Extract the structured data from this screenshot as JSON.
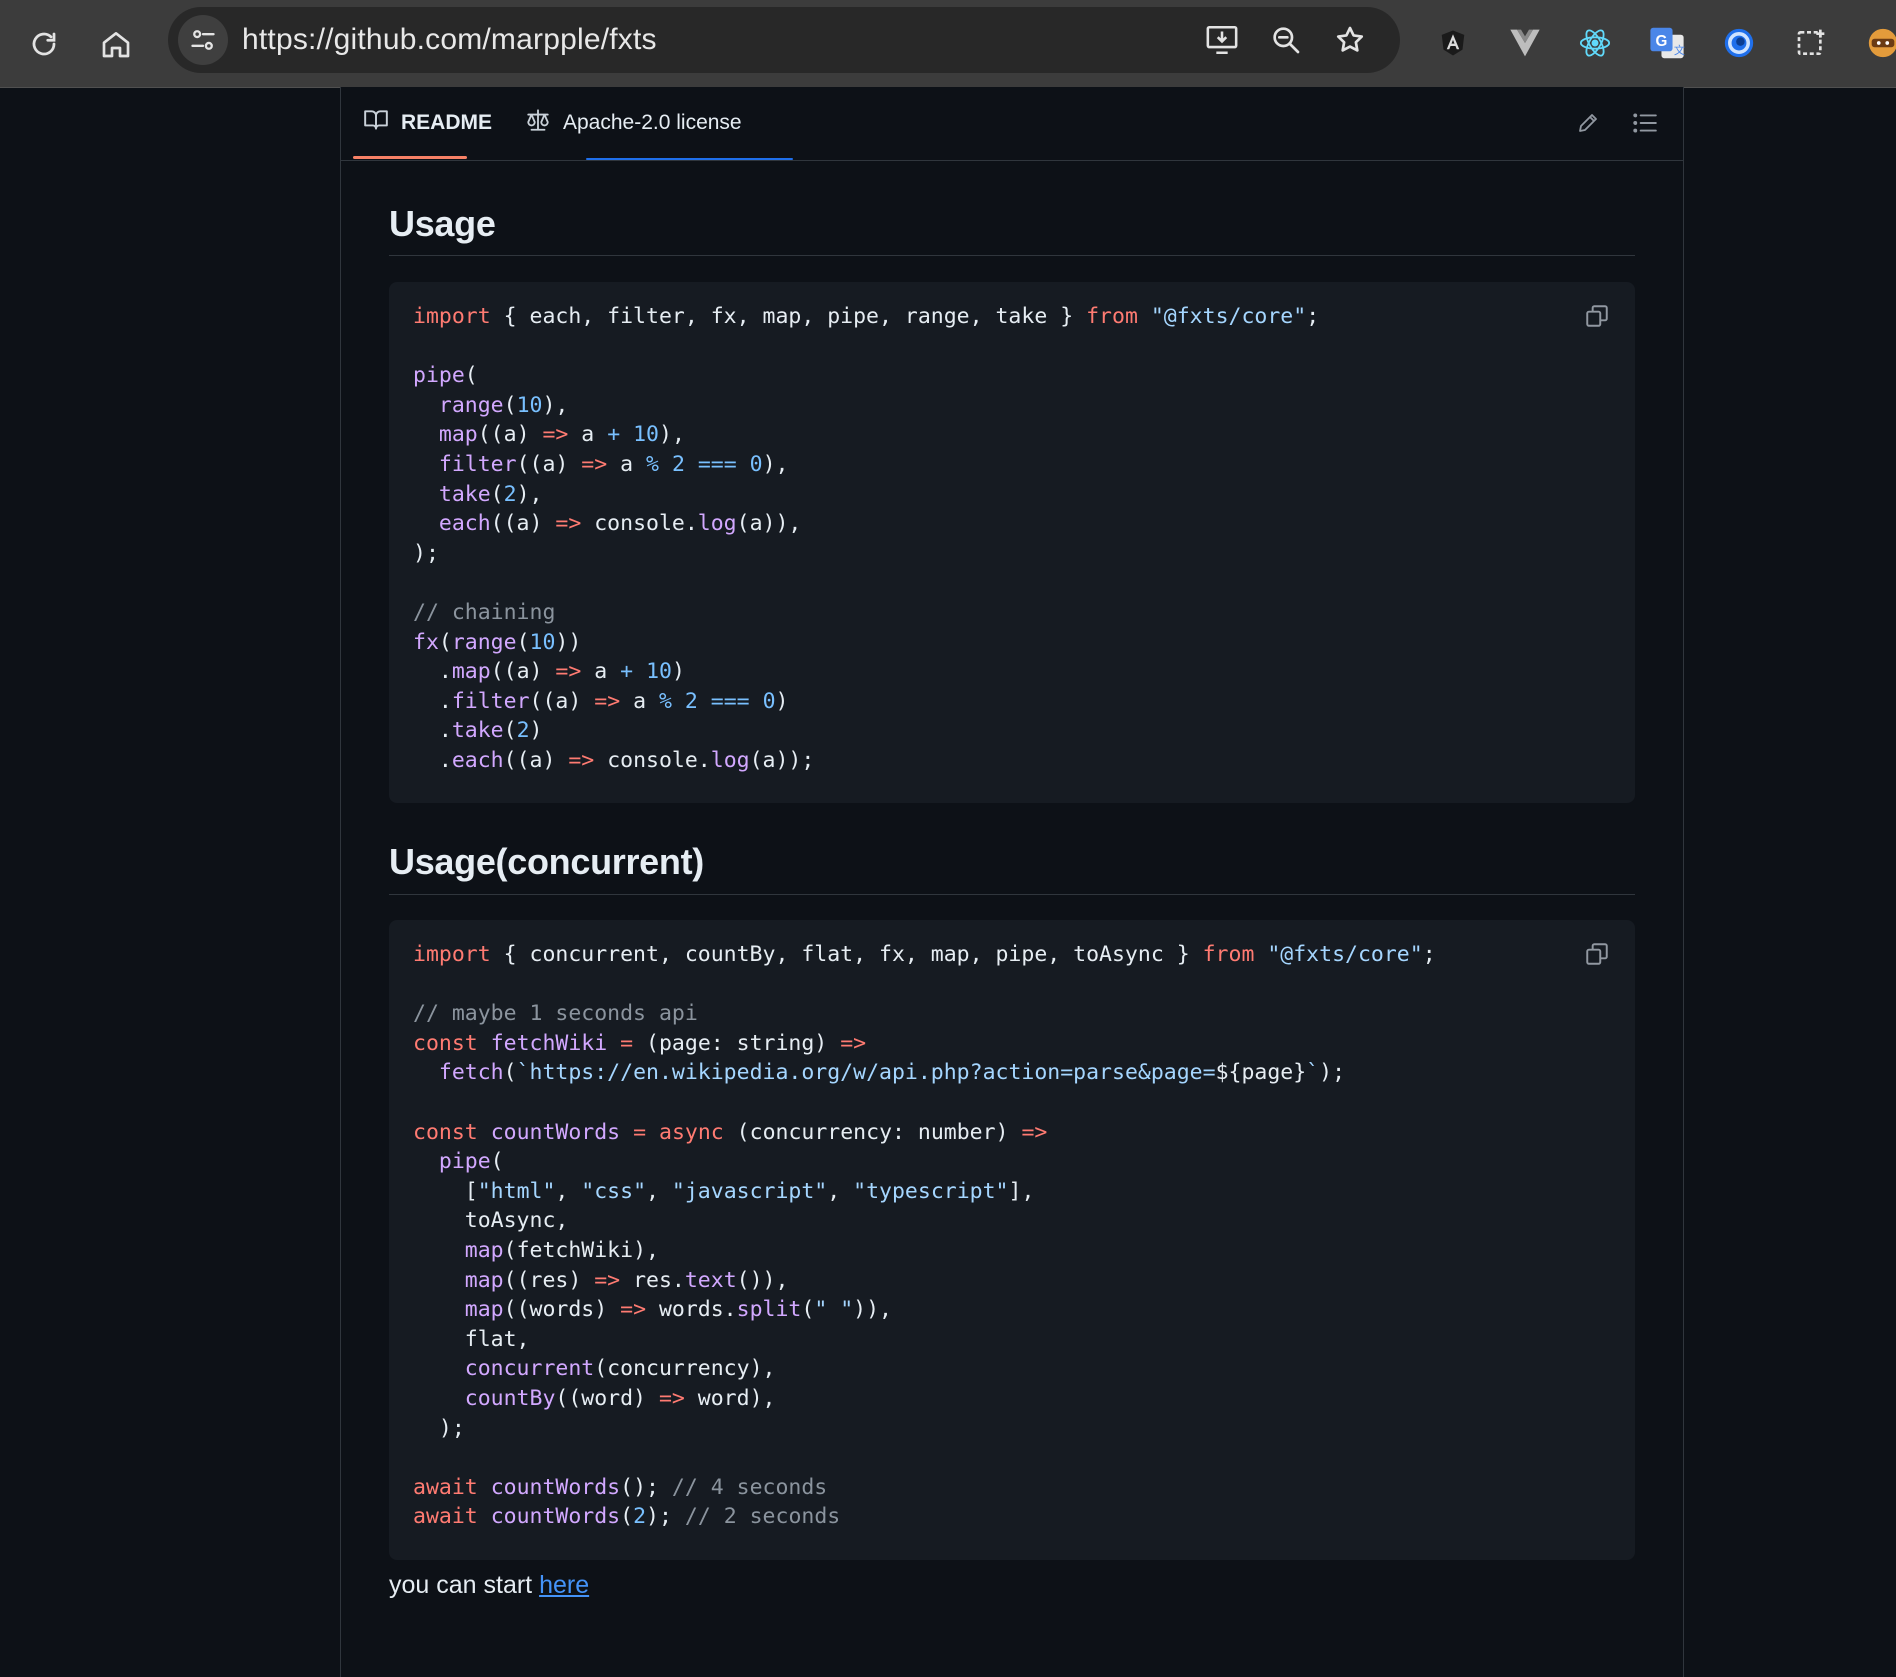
{
  "browser": {
    "url": "https://github.com/marpple/fxts"
  },
  "tabs": [
    {
      "label": "README",
      "icon": "book-icon",
      "active": true
    },
    {
      "label": "Apache-2.0 license",
      "icon": "scale-icon",
      "active": false
    }
  ],
  "sections": [
    {
      "heading": "Usage",
      "code": [
        [
          [
            "k",
            "import"
          ],
          [
            "p",
            " { each, filter, fx, map, pipe, range, take } "
          ],
          [
            "k",
            "from"
          ],
          [
            "p",
            " "
          ],
          [
            "s",
            "\"@fxts/core\""
          ],
          [
            "p",
            ";"
          ]
        ],
        [],
        [
          [
            "f",
            "pipe"
          ],
          [
            "p",
            "("
          ]
        ],
        [
          [
            "p",
            "  "
          ],
          [
            "f",
            "range"
          ],
          [
            "p",
            "("
          ],
          [
            "n",
            "10"
          ],
          [
            "p",
            "),"
          ]
        ],
        [
          [
            "p",
            "  "
          ],
          [
            "f",
            "map"
          ],
          [
            "p",
            "((a) "
          ],
          [
            "k",
            "=>"
          ],
          [
            "p",
            " a "
          ],
          [
            "n",
            "+"
          ],
          [
            "p",
            " "
          ],
          [
            "n",
            "10"
          ],
          [
            "p",
            "),"
          ]
        ],
        [
          [
            "p",
            "  "
          ],
          [
            "f",
            "filter"
          ],
          [
            "p",
            "((a) "
          ],
          [
            "k",
            "=>"
          ],
          [
            "p",
            " a "
          ],
          [
            "n",
            "%"
          ],
          [
            "p",
            " "
          ],
          [
            "n",
            "2"
          ],
          [
            "p",
            " "
          ],
          [
            "n",
            "==="
          ],
          [
            "p",
            " "
          ],
          [
            "n",
            "0"
          ],
          [
            "p",
            "),"
          ]
        ],
        [
          [
            "p",
            "  "
          ],
          [
            "f",
            "take"
          ],
          [
            "p",
            "("
          ],
          [
            "n",
            "2"
          ],
          [
            "p",
            "),"
          ]
        ],
        [
          [
            "p",
            "  "
          ],
          [
            "f",
            "each"
          ],
          [
            "p",
            "((a) "
          ],
          [
            "k",
            "=>"
          ],
          [
            "p",
            " console."
          ],
          [
            "f",
            "log"
          ],
          [
            "p",
            "(a)),"
          ]
        ],
        [
          [
            "p",
            ");"
          ]
        ],
        [],
        [
          [
            "c",
            "// chaining"
          ]
        ],
        [
          [
            "f",
            "fx"
          ],
          [
            "p",
            "("
          ],
          [
            "f",
            "range"
          ],
          [
            "p",
            "("
          ],
          [
            "n",
            "10"
          ],
          [
            "p",
            "))"
          ]
        ],
        [
          [
            "p",
            "  ."
          ],
          [
            "f",
            "map"
          ],
          [
            "p",
            "((a) "
          ],
          [
            "k",
            "=>"
          ],
          [
            "p",
            " a "
          ],
          [
            "n",
            "+"
          ],
          [
            "p",
            " "
          ],
          [
            "n",
            "10"
          ],
          [
            "p",
            ")"
          ]
        ],
        [
          [
            "p",
            "  ."
          ],
          [
            "f",
            "filter"
          ],
          [
            "p",
            "((a) "
          ],
          [
            "k",
            "=>"
          ],
          [
            "p",
            " a "
          ],
          [
            "n",
            "%"
          ],
          [
            "p",
            " "
          ],
          [
            "n",
            "2"
          ],
          [
            "p",
            " "
          ],
          [
            "n",
            "==="
          ],
          [
            "p",
            " "
          ],
          [
            "n",
            "0"
          ],
          [
            "p",
            ")"
          ]
        ],
        [
          [
            "p",
            "  ."
          ],
          [
            "f",
            "take"
          ],
          [
            "p",
            "("
          ],
          [
            "n",
            "2"
          ],
          [
            "p",
            ")"
          ]
        ],
        [
          [
            "p",
            "  ."
          ],
          [
            "f",
            "each"
          ],
          [
            "p",
            "((a) "
          ],
          [
            "k",
            "=>"
          ],
          [
            "p",
            " console."
          ],
          [
            "f",
            "log"
          ],
          [
            "p",
            "(a));"
          ]
        ]
      ]
    },
    {
      "heading": "Usage(concurrent)",
      "code": [
        [
          [
            "k",
            "import"
          ],
          [
            "p",
            " { concurrent, countBy, flat, fx, map, pipe, toAsync } "
          ],
          [
            "k",
            "from"
          ],
          [
            "p",
            " "
          ],
          [
            "s",
            "\"@fxts/core\""
          ],
          [
            "p",
            ";"
          ]
        ],
        [],
        [
          [
            "c",
            "// maybe 1 seconds api"
          ]
        ],
        [
          [
            "k",
            "const"
          ],
          [
            "p",
            " "
          ],
          [
            "f",
            "fetchWiki"
          ],
          [
            "p",
            " "
          ],
          [
            "k",
            "="
          ],
          [
            "p",
            " (page: string) "
          ],
          [
            "k",
            "=>"
          ]
        ],
        [
          [
            "p",
            "  "
          ],
          [
            "f",
            "fetch"
          ],
          [
            "p",
            "("
          ],
          [
            "s",
            "`https://en.wikipedia.org/w/api.php?action=parse&page="
          ],
          [
            "p",
            "${page}"
          ],
          [
            "s",
            "`"
          ],
          [
            "p",
            ");"
          ]
        ],
        [],
        [
          [
            "k",
            "const"
          ],
          [
            "p",
            " "
          ],
          [
            "f",
            "countWords"
          ],
          [
            "p",
            " "
          ],
          [
            "k",
            "="
          ],
          [
            "p",
            " "
          ],
          [
            "k",
            "async"
          ],
          [
            "p",
            " (concurrency: number) "
          ],
          [
            "k",
            "=>"
          ]
        ],
        [
          [
            "p",
            "  "
          ],
          [
            "f",
            "pipe"
          ],
          [
            "p",
            "("
          ]
        ],
        [
          [
            "p",
            "    ["
          ],
          [
            "s",
            "\"html\""
          ],
          [
            "p",
            ", "
          ],
          [
            "s",
            "\"css\""
          ],
          [
            "p",
            ", "
          ],
          [
            "s",
            "\"javascript\""
          ],
          [
            "p",
            ", "
          ],
          [
            "s",
            "\"typescript\""
          ],
          [
            "p",
            "],"
          ]
        ],
        [
          [
            "p",
            "    toAsync,"
          ]
        ],
        [
          [
            "p",
            "    "
          ],
          [
            "f",
            "map"
          ],
          [
            "p",
            "(fetchWiki),"
          ]
        ],
        [
          [
            "p",
            "    "
          ],
          [
            "f",
            "map"
          ],
          [
            "p",
            "((res) "
          ],
          [
            "k",
            "=>"
          ],
          [
            "p",
            " res."
          ],
          [
            "f",
            "text"
          ],
          [
            "p",
            "()),"
          ]
        ],
        [
          [
            "p",
            "    "
          ],
          [
            "f",
            "map"
          ],
          [
            "p",
            "((words) "
          ],
          [
            "k",
            "=>"
          ],
          [
            "p",
            " words."
          ],
          [
            "f",
            "split"
          ],
          [
            "p",
            "("
          ],
          [
            "s",
            "\" \""
          ],
          [
            "p",
            ")),"
          ]
        ],
        [
          [
            "p",
            "    flat,"
          ]
        ],
        [
          [
            "p",
            "    "
          ],
          [
            "f",
            "concurrent"
          ],
          [
            "p",
            "(concurrency),"
          ]
        ],
        [
          [
            "p",
            "    "
          ],
          [
            "f",
            "countBy"
          ],
          [
            "p",
            "((word) "
          ],
          [
            "k",
            "=>"
          ],
          [
            "p",
            " word),"
          ]
        ],
        [
          [
            "p",
            "  );"
          ]
        ],
        [],
        [
          [
            "k",
            "await"
          ],
          [
            "p",
            " "
          ],
          [
            "f",
            "countWords"
          ],
          [
            "p",
            "(); "
          ],
          [
            "c",
            "// 4 seconds"
          ]
        ],
        [
          [
            "k",
            "await"
          ],
          [
            "p",
            " "
          ],
          [
            "f",
            "countWords"
          ],
          [
            "p",
            "("
          ],
          [
            "n",
            "2"
          ],
          [
            "p",
            "); "
          ],
          [
            "c",
            "// 2 seconds"
          ]
        ]
      ]
    }
  ],
  "footer_text": {
    "prefix": "you can start ",
    "link": "here"
  },
  "colors": {
    "keyword": "#ff7b72",
    "string": "#a5d6ff",
    "function": "#d2a8ff",
    "number": "#79c0ff",
    "comment": "#8b949e",
    "active_tab_underline": "#f78166",
    "link": "#4493f8"
  }
}
